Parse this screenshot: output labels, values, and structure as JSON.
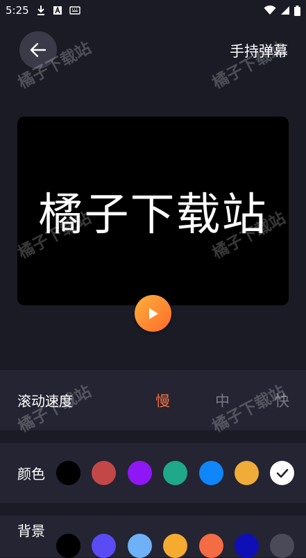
{
  "status_bar": {
    "time": "5:25"
  },
  "header": {
    "title": "手持弹幕"
  },
  "preview": {
    "text": "橘子下载站"
  },
  "speed": {
    "label": "滚动速度",
    "options": [
      "慢",
      "中",
      "快"
    ],
    "selected": "慢"
  },
  "color": {
    "label": "颜色",
    "swatches": [
      "#000000",
      "#c44747",
      "#8f17f6",
      "#1fa88a",
      "#0f86fa",
      "#f0ac38",
      "#ffffff"
    ],
    "selected_index": 6
  },
  "background": {
    "label": "背景",
    "swatches": [
      "#000000",
      "#5b4bf5",
      "#6eb1f7",
      "#f5ab2f",
      "#f36c43",
      "#0f0fb8",
      "#4a4a58"
    ]
  },
  "watermark": {
    "text": "橘子下载站"
  },
  "colors": {
    "accent": "#f2703e",
    "panel": "#242433",
    "background": "#1b1b26"
  }
}
